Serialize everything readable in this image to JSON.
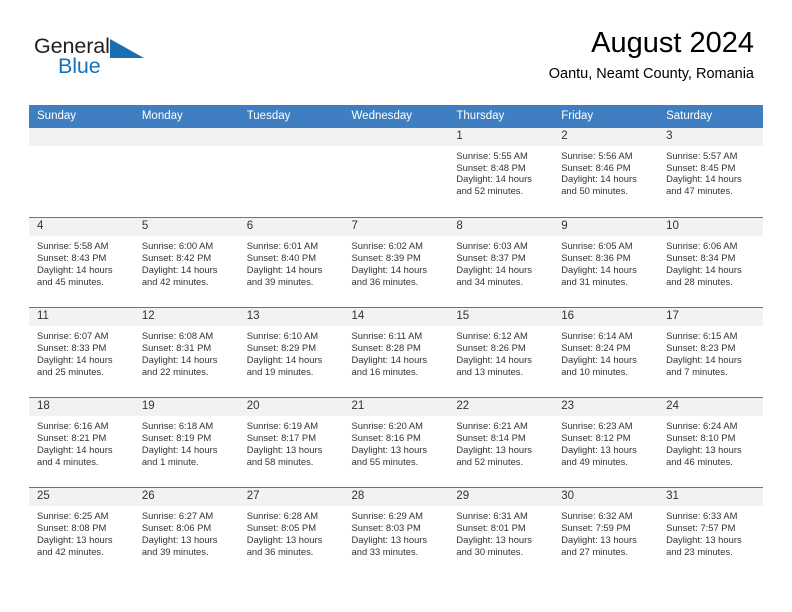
{
  "logo": {
    "word_one": "General",
    "word_two": "Blue",
    "triangle_icon": "triangle-icon",
    "accent_color": "#1573bd"
  },
  "header": {
    "title": "August 2024",
    "subtitle": "Oantu, Neamt County, Romania"
  },
  "calendar": {
    "header_bg": "#3f7fc1",
    "daynum_bg": "#f2f2f2",
    "weekday_headers": [
      "Sunday",
      "Monday",
      "Tuesday",
      "Wednesday",
      "Thursday",
      "Friday",
      "Saturday"
    ],
    "weeks": [
      [
        {
          "day": "",
          "sunrise": "",
          "sunset": "",
          "daylight_line1": "",
          "daylight_line2": ""
        },
        {
          "day": "",
          "sunrise": "",
          "sunset": "",
          "daylight_line1": "",
          "daylight_line2": ""
        },
        {
          "day": "",
          "sunrise": "",
          "sunset": "",
          "daylight_line1": "",
          "daylight_line2": ""
        },
        {
          "day": "",
          "sunrise": "",
          "sunset": "",
          "daylight_line1": "",
          "daylight_line2": ""
        },
        {
          "day": "1",
          "sunrise": "Sunrise: 5:55 AM",
          "sunset": "Sunset: 8:48 PM",
          "daylight_line1": "Daylight: 14 hours",
          "daylight_line2": "and 52 minutes."
        },
        {
          "day": "2",
          "sunrise": "Sunrise: 5:56 AM",
          "sunset": "Sunset: 8:46 PM",
          "daylight_line1": "Daylight: 14 hours",
          "daylight_line2": "and 50 minutes."
        },
        {
          "day": "3",
          "sunrise": "Sunrise: 5:57 AM",
          "sunset": "Sunset: 8:45 PM",
          "daylight_line1": "Daylight: 14 hours",
          "daylight_line2": "and 47 minutes."
        }
      ],
      [
        {
          "day": "4",
          "sunrise": "Sunrise: 5:58 AM",
          "sunset": "Sunset: 8:43 PM",
          "daylight_line1": "Daylight: 14 hours",
          "daylight_line2": "and 45 minutes."
        },
        {
          "day": "5",
          "sunrise": "Sunrise: 6:00 AM",
          "sunset": "Sunset: 8:42 PM",
          "daylight_line1": "Daylight: 14 hours",
          "daylight_line2": "and 42 minutes."
        },
        {
          "day": "6",
          "sunrise": "Sunrise: 6:01 AM",
          "sunset": "Sunset: 8:40 PM",
          "daylight_line1": "Daylight: 14 hours",
          "daylight_line2": "and 39 minutes."
        },
        {
          "day": "7",
          "sunrise": "Sunrise: 6:02 AM",
          "sunset": "Sunset: 8:39 PM",
          "daylight_line1": "Daylight: 14 hours",
          "daylight_line2": "and 36 minutes."
        },
        {
          "day": "8",
          "sunrise": "Sunrise: 6:03 AM",
          "sunset": "Sunset: 8:37 PM",
          "daylight_line1": "Daylight: 14 hours",
          "daylight_line2": "and 34 minutes."
        },
        {
          "day": "9",
          "sunrise": "Sunrise: 6:05 AM",
          "sunset": "Sunset: 8:36 PM",
          "daylight_line1": "Daylight: 14 hours",
          "daylight_line2": "and 31 minutes."
        },
        {
          "day": "10",
          "sunrise": "Sunrise: 6:06 AM",
          "sunset": "Sunset: 8:34 PM",
          "daylight_line1": "Daylight: 14 hours",
          "daylight_line2": "and 28 minutes."
        }
      ],
      [
        {
          "day": "11",
          "sunrise": "Sunrise: 6:07 AM",
          "sunset": "Sunset: 8:33 PM",
          "daylight_line1": "Daylight: 14 hours",
          "daylight_line2": "and 25 minutes."
        },
        {
          "day": "12",
          "sunrise": "Sunrise: 6:08 AM",
          "sunset": "Sunset: 8:31 PM",
          "daylight_line1": "Daylight: 14 hours",
          "daylight_line2": "and 22 minutes."
        },
        {
          "day": "13",
          "sunrise": "Sunrise: 6:10 AM",
          "sunset": "Sunset: 8:29 PM",
          "daylight_line1": "Daylight: 14 hours",
          "daylight_line2": "and 19 minutes."
        },
        {
          "day": "14",
          "sunrise": "Sunrise: 6:11 AM",
          "sunset": "Sunset: 8:28 PM",
          "daylight_line1": "Daylight: 14 hours",
          "daylight_line2": "and 16 minutes."
        },
        {
          "day": "15",
          "sunrise": "Sunrise: 6:12 AM",
          "sunset": "Sunset: 8:26 PM",
          "daylight_line1": "Daylight: 14 hours",
          "daylight_line2": "and 13 minutes."
        },
        {
          "day": "16",
          "sunrise": "Sunrise: 6:14 AM",
          "sunset": "Sunset: 8:24 PM",
          "daylight_line1": "Daylight: 14 hours",
          "daylight_line2": "and 10 minutes."
        },
        {
          "day": "17",
          "sunrise": "Sunrise: 6:15 AM",
          "sunset": "Sunset: 8:23 PM",
          "daylight_line1": "Daylight: 14 hours",
          "daylight_line2": "and 7 minutes."
        }
      ],
      [
        {
          "day": "18",
          "sunrise": "Sunrise: 6:16 AM",
          "sunset": "Sunset: 8:21 PM",
          "daylight_line1": "Daylight: 14 hours",
          "daylight_line2": "and 4 minutes."
        },
        {
          "day": "19",
          "sunrise": "Sunrise: 6:18 AM",
          "sunset": "Sunset: 8:19 PM",
          "daylight_line1": "Daylight: 14 hours",
          "daylight_line2": "and 1 minute."
        },
        {
          "day": "20",
          "sunrise": "Sunrise: 6:19 AM",
          "sunset": "Sunset: 8:17 PM",
          "daylight_line1": "Daylight: 13 hours",
          "daylight_line2": "and 58 minutes."
        },
        {
          "day": "21",
          "sunrise": "Sunrise: 6:20 AM",
          "sunset": "Sunset: 8:16 PM",
          "daylight_line1": "Daylight: 13 hours",
          "daylight_line2": "and 55 minutes."
        },
        {
          "day": "22",
          "sunrise": "Sunrise: 6:21 AM",
          "sunset": "Sunset: 8:14 PM",
          "daylight_line1": "Daylight: 13 hours",
          "daylight_line2": "and 52 minutes."
        },
        {
          "day": "23",
          "sunrise": "Sunrise: 6:23 AM",
          "sunset": "Sunset: 8:12 PM",
          "daylight_line1": "Daylight: 13 hours",
          "daylight_line2": "and 49 minutes."
        },
        {
          "day": "24",
          "sunrise": "Sunrise: 6:24 AM",
          "sunset": "Sunset: 8:10 PM",
          "daylight_line1": "Daylight: 13 hours",
          "daylight_line2": "and 46 minutes."
        }
      ],
      [
        {
          "day": "25",
          "sunrise": "Sunrise: 6:25 AM",
          "sunset": "Sunset: 8:08 PM",
          "daylight_line1": "Daylight: 13 hours",
          "daylight_line2": "and 42 minutes."
        },
        {
          "day": "26",
          "sunrise": "Sunrise: 6:27 AM",
          "sunset": "Sunset: 8:06 PM",
          "daylight_line1": "Daylight: 13 hours",
          "daylight_line2": "and 39 minutes."
        },
        {
          "day": "27",
          "sunrise": "Sunrise: 6:28 AM",
          "sunset": "Sunset: 8:05 PM",
          "daylight_line1": "Daylight: 13 hours",
          "daylight_line2": "and 36 minutes."
        },
        {
          "day": "28",
          "sunrise": "Sunrise: 6:29 AM",
          "sunset": "Sunset: 8:03 PM",
          "daylight_line1": "Daylight: 13 hours",
          "daylight_line2": "and 33 minutes."
        },
        {
          "day": "29",
          "sunrise": "Sunrise: 6:31 AM",
          "sunset": "Sunset: 8:01 PM",
          "daylight_line1": "Daylight: 13 hours",
          "daylight_line2": "and 30 minutes."
        },
        {
          "day": "30",
          "sunrise": "Sunrise: 6:32 AM",
          "sunset": "Sunset: 7:59 PM",
          "daylight_line1": "Daylight: 13 hours",
          "daylight_line2": "and 27 minutes."
        },
        {
          "day": "31",
          "sunrise": "Sunrise: 6:33 AM",
          "sunset": "Sunset: 7:57 PM",
          "daylight_line1": "Daylight: 13 hours",
          "daylight_line2": "and 23 minutes."
        }
      ]
    ]
  }
}
